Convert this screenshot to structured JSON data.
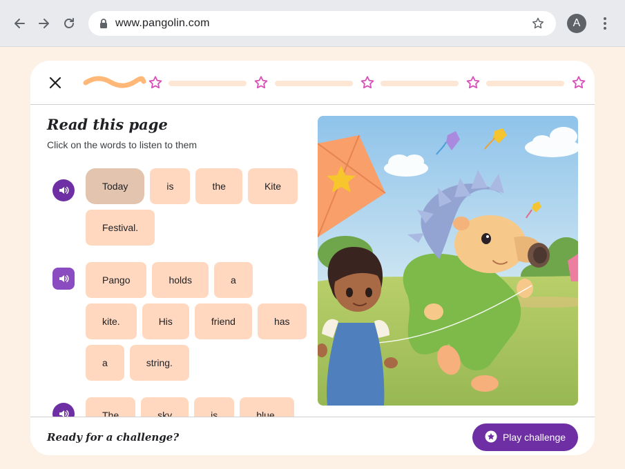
{
  "browser": {
    "url": "www.pangolin.com",
    "avatar_letter": "A"
  },
  "lesson": {
    "progress_segments": 5,
    "heading": "Read this page",
    "subheading": "Click on the words to listen to them"
  },
  "sentences": [
    {
      "words": [
        "Today",
        "is",
        "the",
        "Kite",
        "Festival."
      ],
      "active_word": 0
    },
    {
      "words": [
        "Pango",
        "holds",
        "a",
        "kite.",
        "His",
        "friend",
        "has",
        "a",
        "string."
      ]
    },
    {
      "words": [
        "The",
        "sky",
        "is",
        "blue."
      ]
    }
  ],
  "footer": {
    "question": "Ready for a challenge?",
    "play_label": "Play challenge"
  },
  "colors": {
    "accent_purple": "#6d2fa3",
    "word_chip": "#ffd8bf",
    "star_pink": "#d94fb8",
    "progress_wave": "#ffb877"
  }
}
